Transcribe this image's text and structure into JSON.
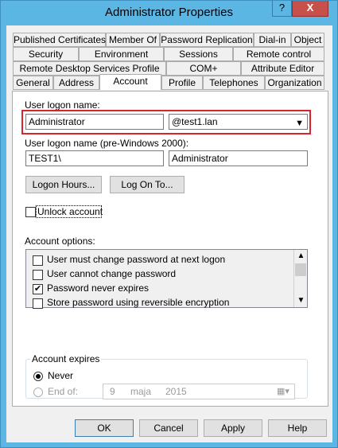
{
  "window": {
    "title": "Administrator Properties",
    "help_glyph": "?",
    "close_glyph": "X"
  },
  "tabs": {
    "row1": [
      "Published Certificates",
      "Member Of",
      "Password Replication",
      "Dial-in",
      "Object"
    ],
    "row2": [
      "Security",
      "Environment",
      "Sessions",
      "Remote control"
    ],
    "row3": [
      "Remote Desktop Services Profile",
      "COM+",
      "Attribute Editor"
    ],
    "row4": [
      "General",
      "Address",
      "Account",
      "Profile",
      "Telephones",
      "Organization"
    ],
    "active": "Account"
  },
  "account": {
    "logon_name_label": "User logon name:",
    "logon_name_value": "Administrator",
    "domain_value": "@test1.lan",
    "pre2000_label": "User logon name (pre-Windows 2000):",
    "pre2000_domain": "TEST1\\",
    "pre2000_user": "Administrator",
    "logon_hours_button": "Logon Hours...",
    "log_on_to_button": "Log On To...",
    "unlock_label": "Unlock account",
    "account_options_label": "Account options:",
    "options": [
      {
        "label": "User must change password at next logon",
        "checked": false
      },
      {
        "label": "User cannot change password",
        "checked": false
      },
      {
        "label": "Password never expires",
        "checked": true
      },
      {
        "label": "Store password using reversible encryption",
        "checked": false
      }
    ],
    "expires_group_label": "Account expires",
    "never_label": "Never",
    "end_of_label": "End of:",
    "end_date": {
      "day": "9",
      "month": "maja",
      "year": "2015"
    }
  },
  "buttons": {
    "ok": "OK",
    "cancel": "Cancel",
    "apply": "Apply",
    "help": "Help"
  }
}
